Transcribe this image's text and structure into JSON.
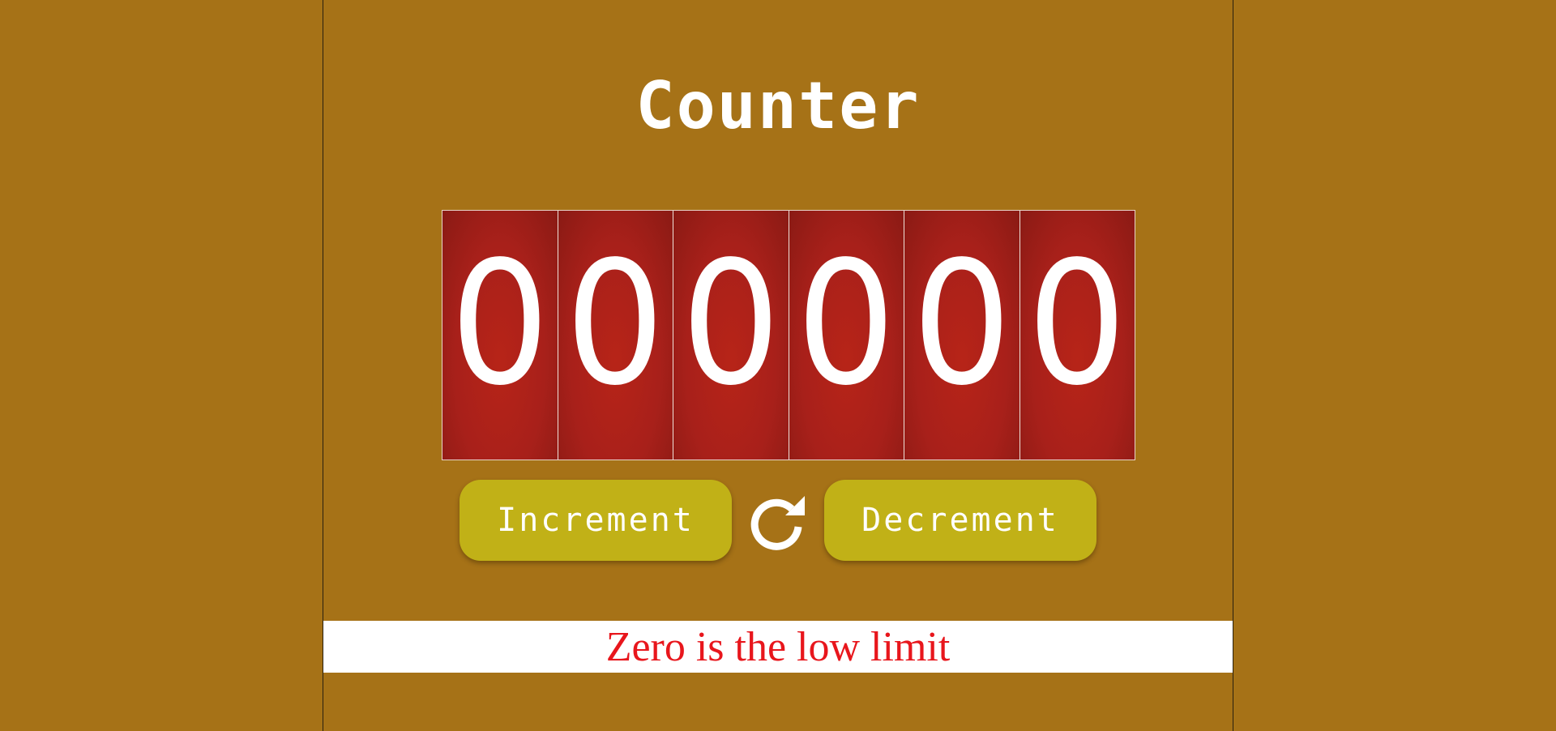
{
  "title": "Counter",
  "counter": {
    "digits": [
      "0",
      "0",
      "0",
      "0",
      "0",
      "0"
    ]
  },
  "buttons": {
    "increment_label": "Increment",
    "decrement_label": "Decrement",
    "reset_icon": "refresh-icon"
  },
  "message": "Zero is the low limit",
  "colors": {
    "background": "#a67217",
    "digit_tile": "#a8201a",
    "button": "#c1b117",
    "message_text": "#e8161c",
    "message_bg": "#ffffff"
  }
}
